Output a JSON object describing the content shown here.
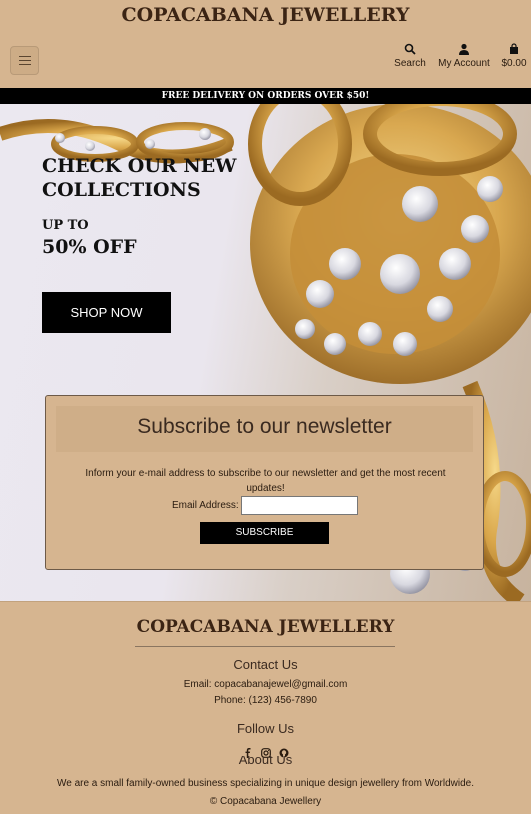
{
  "header": {
    "brand": "COPACABANA JEWELLERY",
    "menu_icon": "hamburger-menu-icon",
    "search_label": "Search",
    "account_label": "My Account",
    "cart_label": "$0.00"
  },
  "promo": {
    "text": "FREE DELIVERY ON ORDERS OVER $50!"
  },
  "hero": {
    "title_line1": "CHECK OUR NEW",
    "title_line2": "COLLECTIONS",
    "upto": "UP TO",
    "discount": "50% OFF",
    "cta": "SHOP NOW"
  },
  "newsletter": {
    "heading": "Subscribe to our newsletter",
    "text": "Inform your e-mail address to subscribe to our newsletter and get the most recent updates!",
    "email_label": "Email Address:",
    "email_value": "",
    "button": "SUBSCRIBE"
  },
  "footer": {
    "brand": "COPACABANA JEWELLERY",
    "contact_heading": "Contact Us",
    "email_line": "Email: copacabanajewel@gmail.com",
    "phone_line": "Phone: (123) 456-7890",
    "follow_heading": "Follow Us",
    "socials": [
      "facebook-icon",
      "instagram-icon",
      "github-icon"
    ],
    "about_heading": "About Us",
    "about_text": "We are a small family-owned business specializing in unique design jewellery from Worldwide.",
    "copyright": "© Copacabana Jewellery"
  },
  "colors": {
    "tan": "#d6b590",
    "black": "#000000",
    "brand_brown": "#3b2414"
  }
}
